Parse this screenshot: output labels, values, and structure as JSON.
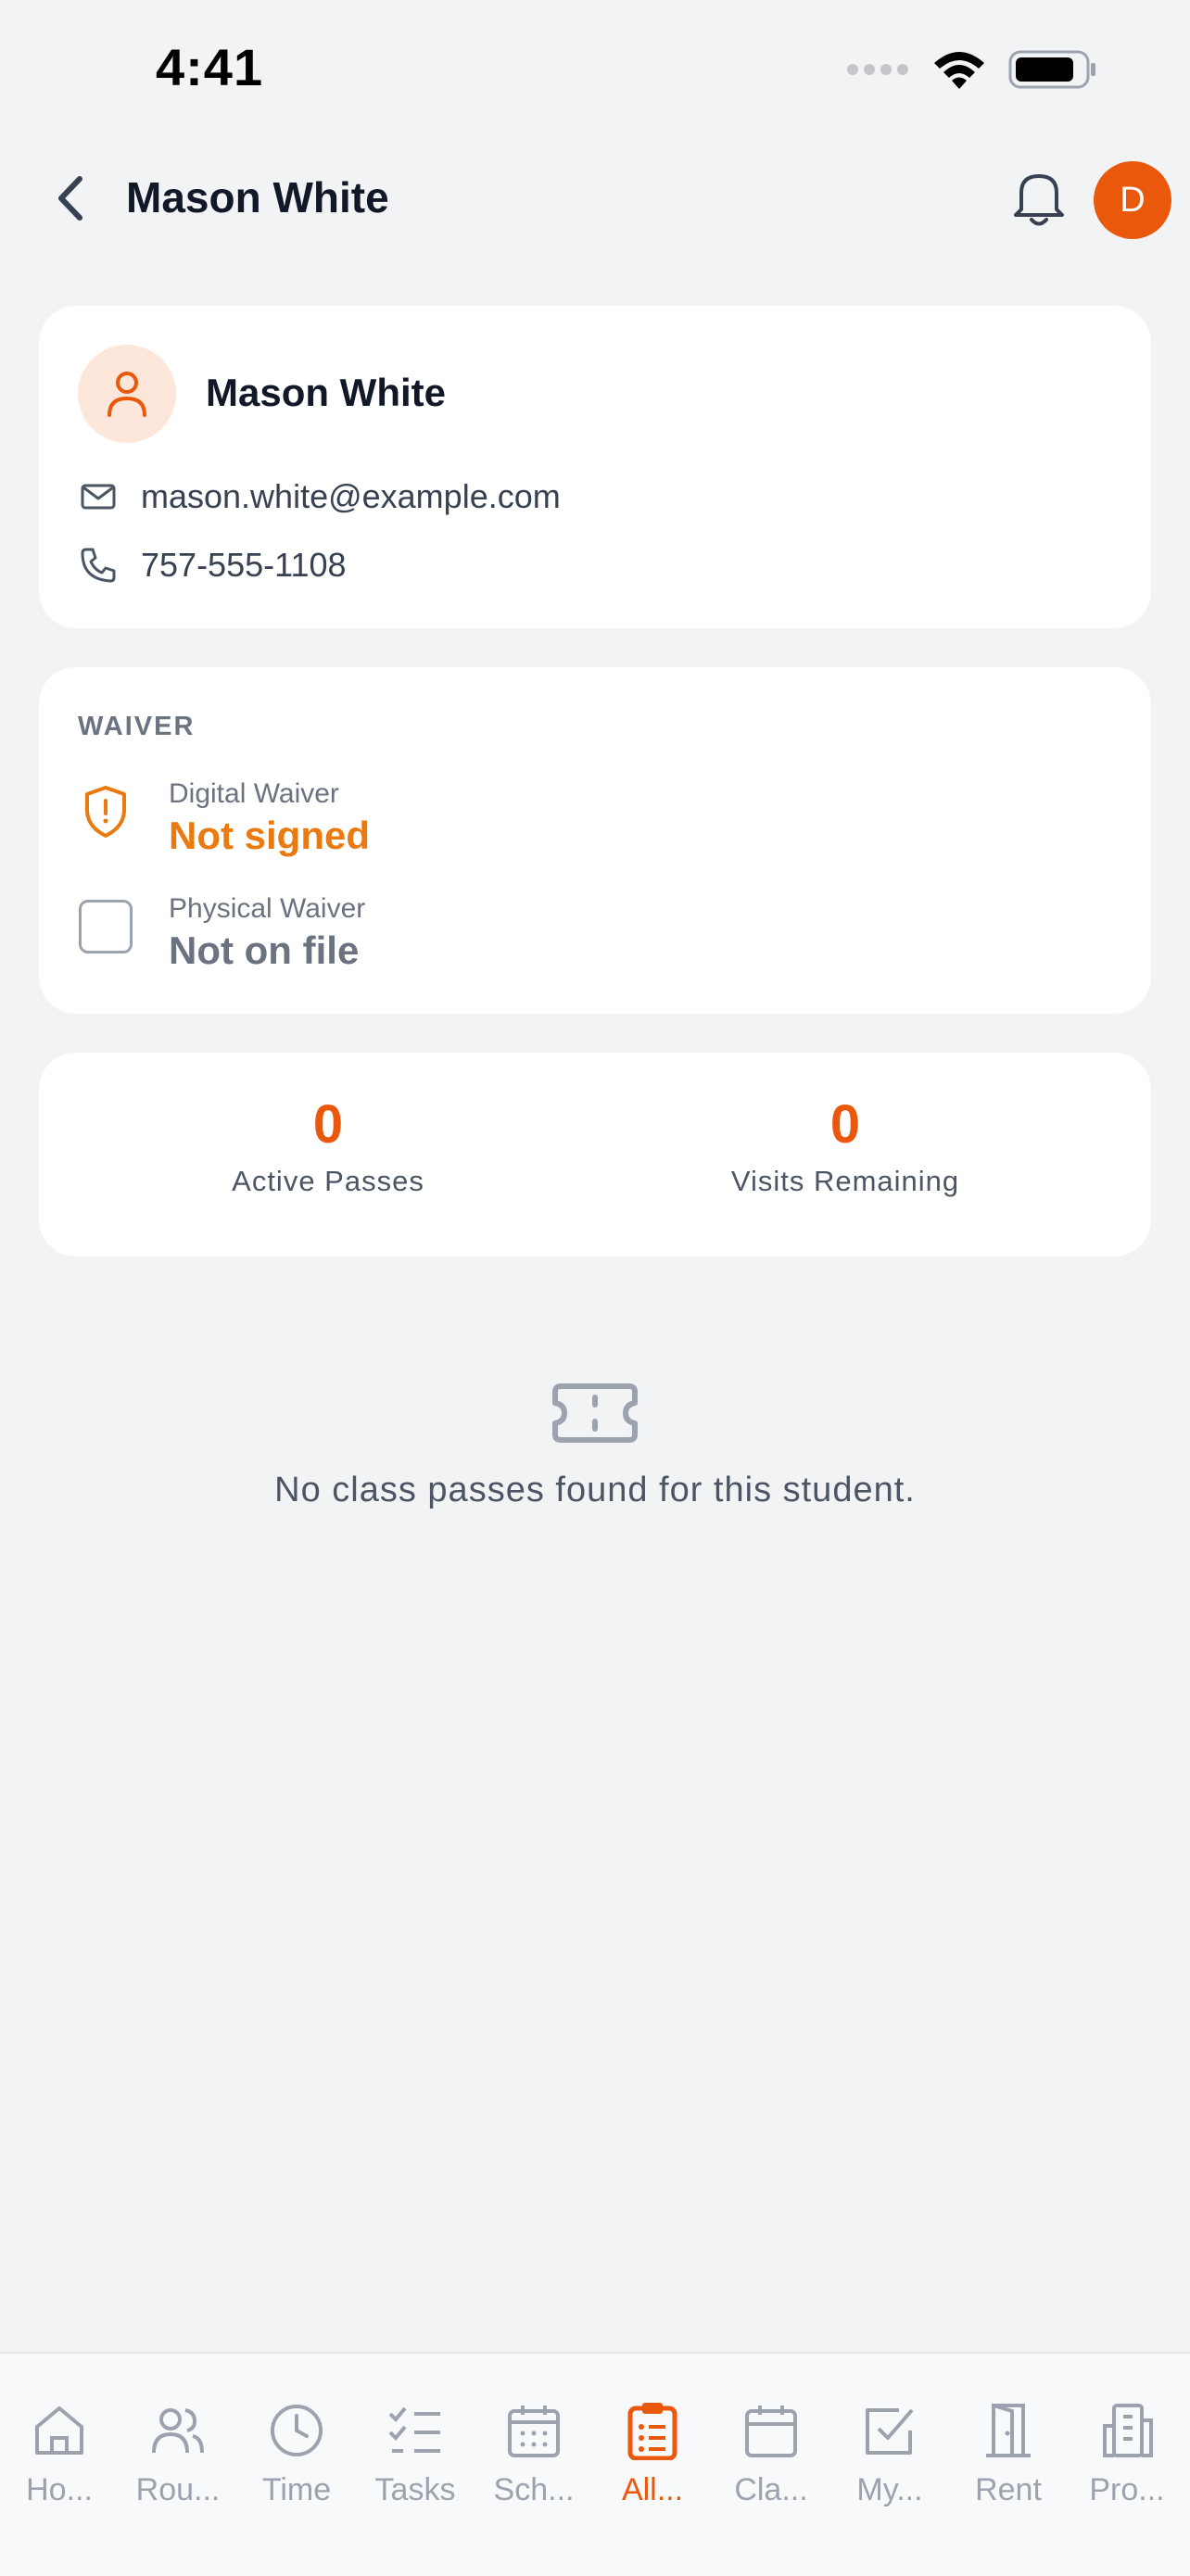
{
  "status_bar": {
    "time": "4:41"
  },
  "header": {
    "title": "Mason White",
    "avatar_initial": "D"
  },
  "contact": {
    "name": "Mason White",
    "email": "mason.white@example.com",
    "phone": "757-555-1108"
  },
  "waiver": {
    "section_label": "WAIVER",
    "digital": {
      "label": "Digital Waiver",
      "status": "Not signed"
    },
    "physical": {
      "label": "Physical Waiver",
      "status": "Not on file"
    }
  },
  "stats": {
    "active_passes": {
      "value": "0",
      "label": "Active Passes"
    },
    "visits_remaining": {
      "value": "0",
      "label": "Visits Remaining"
    }
  },
  "empty_state": {
    "text": "No class passes found for this student."
  },
  "tabs": [
    {
      "label": "Ho...",
      "icon": "home-icon"
    },
    {
      "label": "Rou...",
      "icon": "users-icon"
    },
    {
      "label": "Time",
      "icon": "clock-icon"
    },
    {
      "label": "Tasks",
      "icon": "checklist-icon"
    },
    {
      "label": "Sch...",
      "icon": "calendar-grid-icon"
    },
    {
      "label": "All...",
      "icon": "clipboard-list-icon",
      "active": true
    },
    {
      "label": "Cla...",
      "icon": "calendar-icon"
    },
    {
      "label": "My...",
      "icon": "checkbox-icon"
    },
    {
      "label": "Rent",
      "icon": "door-icon"
    },
    {
      "label": "Pro...",
      "icon": "building-icon"
    }
  ],
  "colors": {
    "accent": "#ea580c",
    "warning": "#ea7a10",
    "background": "#f2f3f5"
  }
}
